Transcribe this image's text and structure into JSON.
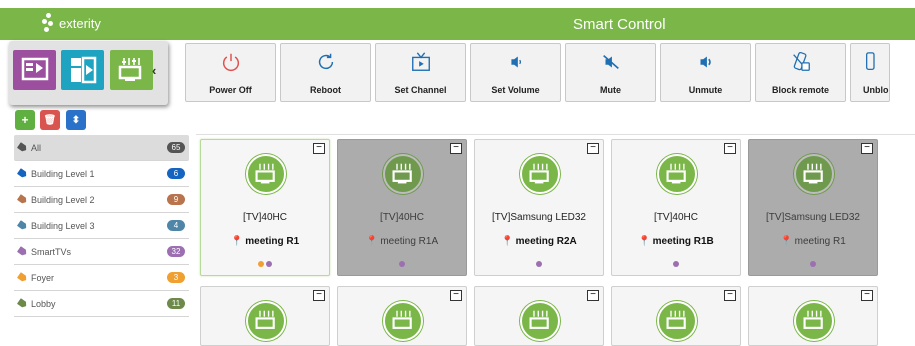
{
  "header": {
    "logo_text": "exterity",
    "title": "Smart Control"
  },
  "colors": {
    "accent": "#7ab648",
    "purple": "#9c4f9e",
    "teal": "#1ea4c0"
  },
  "view_switcher": {
    "items": [
      "list-view-icon",
      "grid-view-icon",
      "tile-view-icon"
    ],
    "collapse": "‹"
  },
  "toolbar": {
    "buttons": [
      {
        "label": "Power Off",
        "icon": "power-icon"
      },
      {
        "label": "Reboot",
        "icon": "reboot-icon"
      },
      {
        "label": "Set Channel",
        "icon": "tv-channel-icon"
      },
      {
        "label": "Set Volume",
        "icon": "volume-icon"
      },
      {
        "label": "Mute",
        "icon": "mute-icon"
      },
      {
        "label": "Unmute",
        "icon": "unmute-icon"
      },
      {
        "label": "Block remote",
        "icon": "block-remote-icon"
      },
      {
        "label": "Unblo",
        "icon": "unblock-remote-icon"
      }
    ]
  },
  "actions": {
    "add": "+",
    "delete": "🗑",
    "sort": "⬍"
  },
  "groups": [
    {
      "label": "All",
      "count": "65",
      "color": "#555555",
      "badge": "#555555"
    },
    {
      "label": "Building Level 1",
      "count": "6",
      "color": "#1565c0",
      "badge": "#1565c0"
    },
    {
      "label": "Building Level 2",
      "count": "9",
      "color": "#b8744d",
      "badge": "#b8744d"
    },
    {
      "label": "Building Level 3",
      "count": "4",
      "color": "#4f86a8",
      "badge": "#4f86a8"
    },
    {
      "label": "SmartTVs",
      "count": "32",
      "color": "#9c6fb0",
      "badge": "#9c6fb0"
    },
    {
      "label": "Foyer",
      "count": "3",
      "color": "#f0a030",
      "badge": "#f0a030"
    },
    {
      "label": "Lobby",
      "count": "11",
      "color": "#6d8a4a",
      "badge": "#6d8a4a"
    }
  ],
  "devices": [
    {
      "name": "[TV]40HC",
      "location": "meeting R1",
      "state": "selected",
      "dots": [
        "#f0a030",
        "#9c6fb0"
      ]
    },
    {
      "name": "[TV]40HC",
      "location": "meeting  R1A",
      "state": "offline",
      "dots": [
        "#9c6fb0"
      ]
    },
    {
      "name": "[TV]Samsung LED32",
      "location": "meeting R2A",
      "state": "online",
      "dots": [
        "#9c6fb0"
      ]
    },
    {
      "name": "[TV]40HC",
      "location": "meeting  R1B",
      "state": "online",
      "dots": [
        "#9c6fb0"
      ]
    },
    {
      "name": "[TV]Samsung LED32",
      "location": "meeting  R1",
      "state": "offline",
      "dots": [
        "#9c6fb0"
      ]
    }
  ],
  "tile_minus": "−"
}
